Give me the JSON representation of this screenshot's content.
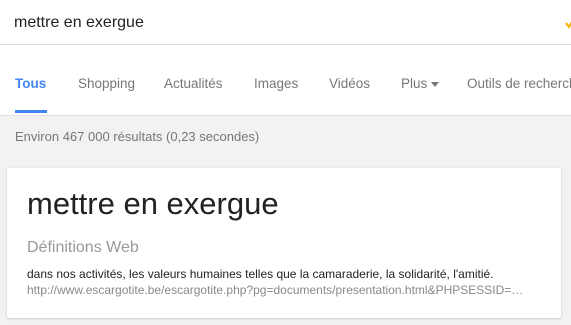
{
  "search": {
    "query": "mettre en exergue"
  },
  "tabs": [
    {
      "label": "Tous"
    },
    {
      "label": "Shopping"
    },
    {
      "label": "Actualités"
    },
    {
      "label": "Images"
    },
    {
      "label": "Vidéos"
    },
    {
      "label": "Plus"
    },
    {
      "label": "Outils de recherche"
    }
  ],
  "stats": {
    "text": "Environ 467 000 résultats (0,23 secondes)"
  },
  "card": {
    "title": "mettre en exergue",
    "subtitle": "Définitions Web",
    "definition": "dans nos activités, les valeurs humaines telles que la camaraderie, la solidarité, l'amitié.",
    "url": "http://www.escargotite.be/escargotite.php?pg=documents/presentation.html&PHPSESSID=…"
  },
  "colors": {
    "accent": "#4285f4",
    "background": "#f2f2f2",
    "mic_yellow": "#f4b400"
  },
  "icons": {
    "more_tab": "caret-down-icon",
    "search_box": "microphone-icon"
  }
}
